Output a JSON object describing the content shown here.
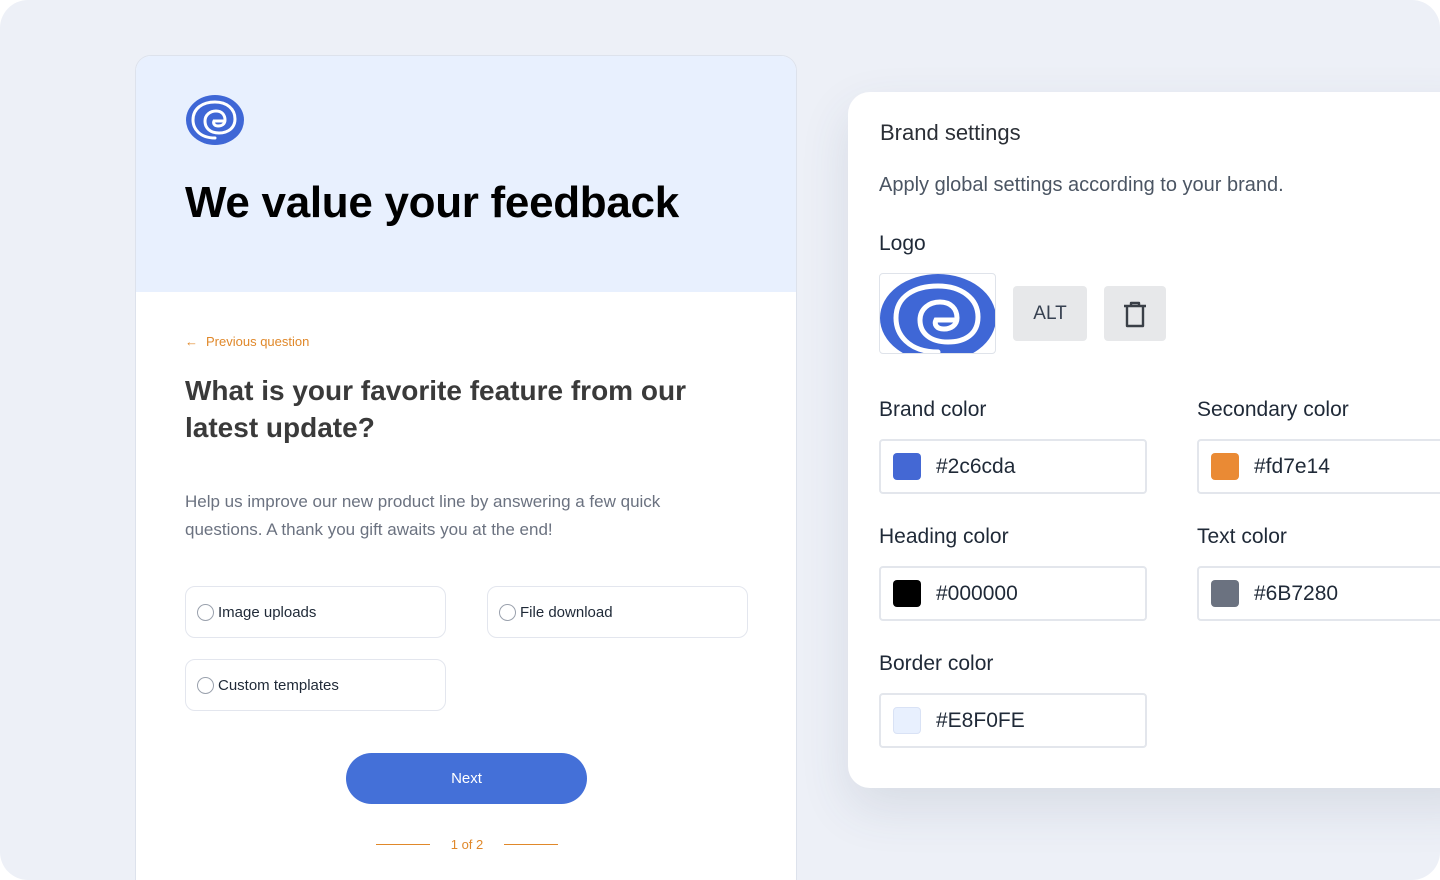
{
  "survey": {
    "title": "We value your feedback",
    "previous_label": "Previous question",
    "question": "What is your favorite feature from our latest update?",
    "helper": "Help us improve our new product line by answering a few quick questions. A thank you gift awaits you at the end!",
    "options": [
      "Image uploads",
      "File download",
      "Custom templates"
    ],
    "next_label": "Next",
    "pager_label": "1 of 2"
  },
  "brand": {
    "title": "Brand settings",
    "subtitle": "Apply global settings according to your brand.",
    "logo_label": "Logo",
    "alt_label": "ALT",
    "delete_icon": "trash-icon",
    "fields": [
      {
        "label": "Brand color",
        "value": "#2c6cda",
        "swatch": "#4468d4"
      },
      {
        "label": "Secondary color",
        "value": "#fd7e14",
        "swatch": "#ea8a34"
      },
      {
        "label": "Heading color",
        "value": "#000000",
        "swatch": "#000000"
      },
      {
        "label": "Text color",
        "value": "#6B7280",
        "swatch": "#6b7280"
      },
      {
        "label": "Border color",
        "value": "#E8F0FE",
        "swatch": "#e8f0fe"
      }
    ]
  },
  "colors": {
    "accent": "#4470d8",
    "orange": "#e0882a",
    "header_bg": "#e8f0fe"
  }
}
